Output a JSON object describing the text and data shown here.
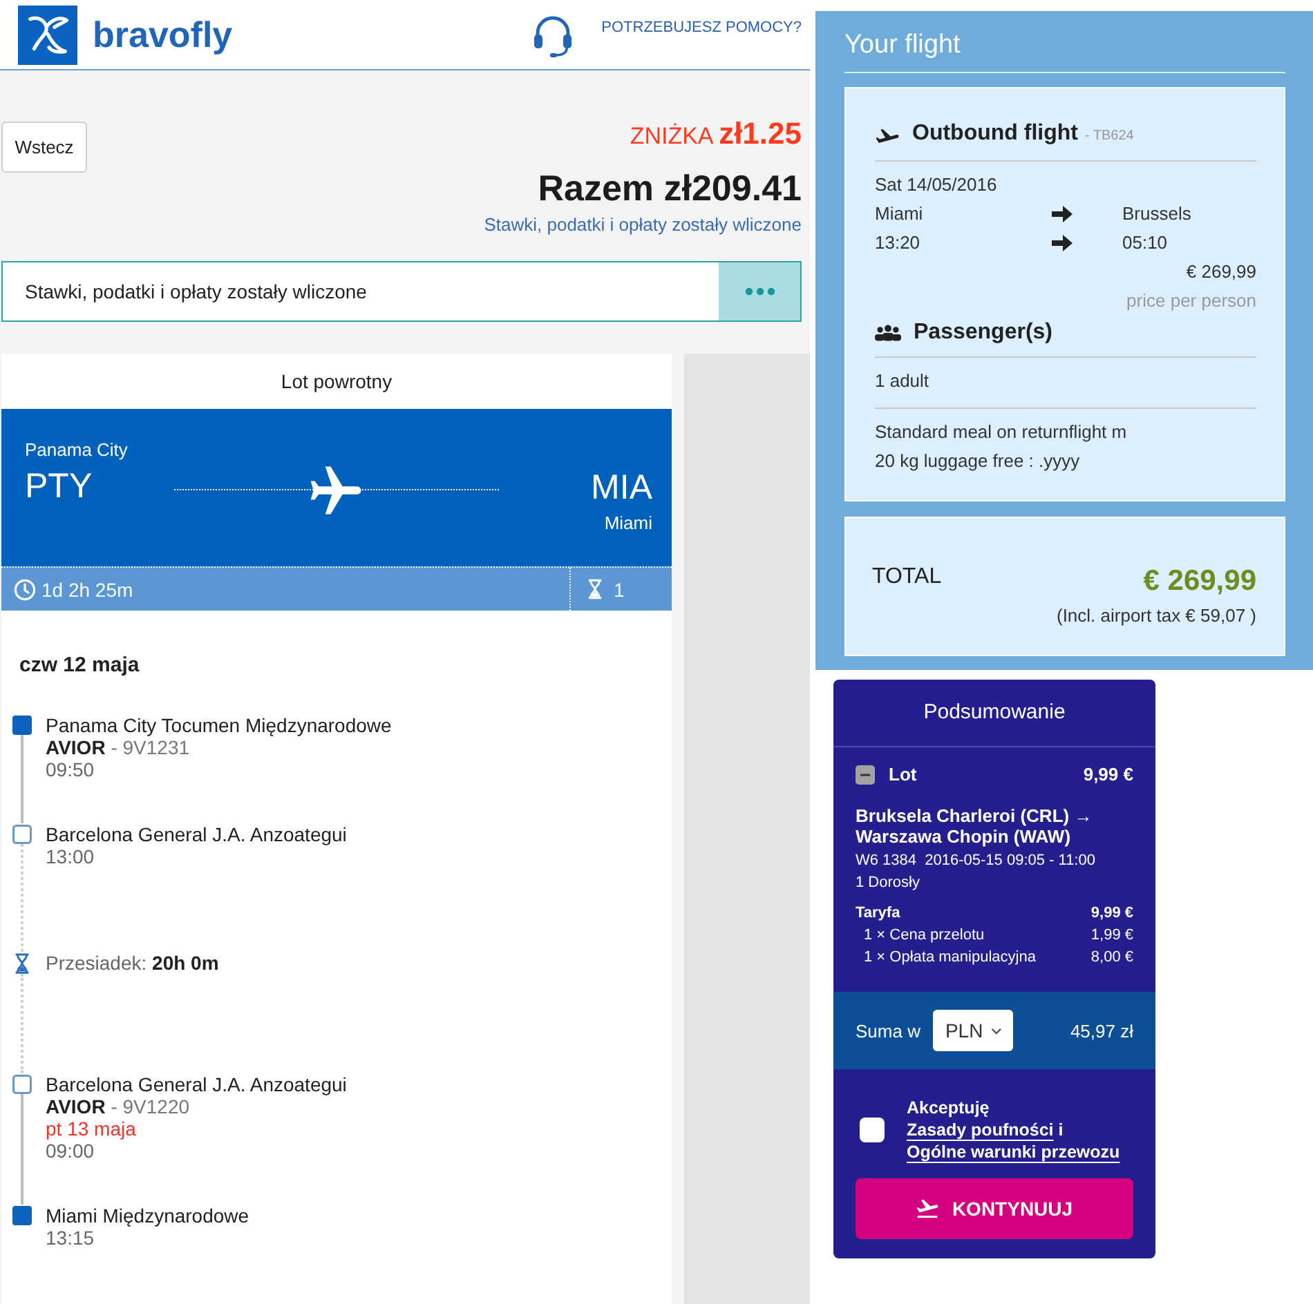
{
  "header": {
    "logo": "bravofly",
    "help": "POTRZEBUJESZ POMOCY?"
  },
  "price_summary": {
    "back_button": "Wstecz",
    "discount": "ZNIŻKA **zł1.25**",
    "total": "Razem zł209.41",
    "note": "Stawki, podatki i opłaty zostały wliczone"
  },
  "fare_bar": {
    "text": "Stawki, podatki i opłaty zostały wliczone"
  },
  "return_flight": {
    "title": "Lot powrotny",
    "origin": {
      "city": "Panama City",
      "code": "PTY"
    },
    "destination": {
      "code": "MIA",
      "city": "Miami"
    },
    "duration": "1d 2h 25m",
    "stops": "1",
    "date": "czw 12 maja",
    "timeline": [
      {
        "kind": "terminal",
        "airport": "Panama City Tocumen Międzynarodowe",
        "flight": "**AVIOR** - 9V1231",
        "time": "09:50"
      },
      {
        "kind": "stop",
        "airport": "Barcelona General J.A. Anzoategui",
        "time": "13:00"
      },
      {
        "kind": "layover",
        "text": "Przesiadek: **20h 0m**"
      },
      {
        "kind": "stop",
        "airport": "Barcelona General J.A. Anzoategui",
        "flight": "**AVIOR** - 9V1220",
        "day": "pt 13 maja",
        "time": "09:00"
      },
      {
        "kind": "terminal",
        "airport": "Miami Międzynarodowe",
        "time": "13:15"
      }
    ]
  },
  "your_flight": {
    "title": "Your flight",
    "outbound": {
      "title": "Outbound flight",
      "code": "- TB624",
      "date": "Sat 14/05/2016",
      "from": "Miami",
      "to": "Brussels",
      "departs": "13:20",
      "arrives": "05:10",
      "price": "€ 269,99",
      "price_note": "price per person"
    },
    "passengers": {
      "title": "Passenger(s)",
      "count": "1 adult",
      "extras": [
        "Standard meal on returnflight m",
        "20 kg luggage free : .yyyy"
      ]
    },
    "total": {
      "label": "TOTAL",
      "amount": "€ 269,99",
      "tax_note": "(Incl. airport tax € 59,07 )"
    }
  },
  "booking_summary": {
    "title": "Podsumowanie",
    "item": {
      "label": "Lot",
      "expanded": true,
      "price": "9,99 €",
      "route": "Bruksela Charleroi (CRL) → Warszawa Chopin (WAW)",
      "details": "W6 1384  2016-05-15 09:05 - 11:00",
      "passengers": "1 Dorosły",
      "fare_lines": [
        {
          "kind": "total",
          "label": "Taryfa",
          "amount": "9,99 €"
        },
        {
          "kind": "part",
          "label": "1 × Cena przelotu",
          "amount": "1,99 €"
        },
        {
          "kind": "part",
          "label": "1 × Opłata manipulacyjna",
          "amount": "8,00 €"
        }
      ]
    },
    "sum_label": "Suma w",
    "currency": "PLN",
    "sum": "45,97 zł",
    "consent": {
      "checked": false,
      "text": "Akceptuję",
      "link_1": "Zasady poufności",
      "joiner": "i",
      "link_2": "Ogólne warunki przewozu"
    },
    "continue_button": "KONTYNUUJ"
  }
}
